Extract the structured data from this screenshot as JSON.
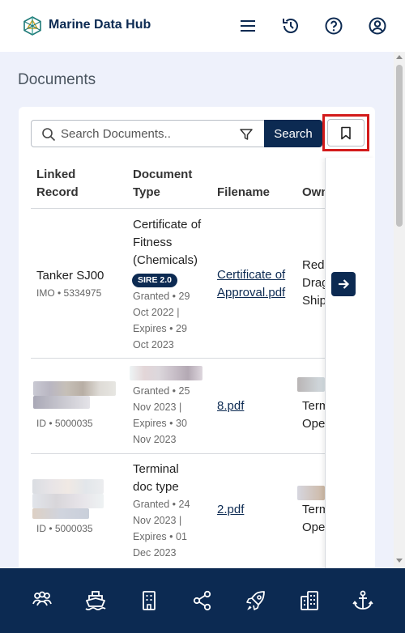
{
  "header": {
    "brand": "Marine Data Hub",
    "icons": [
      "hex-logo-icon",
      "menu-icon",
      "history-icon",
      "help-icon",
      "account-icon"
    ]
  },
  "page": {
    "title": "Documents"
  },
  "search": {
    "placeholder": "Search Documents..",
    "button_label": "Search"
  },
  "table": {
    "columns": [
      "Linked Record",
      "Document Type",
      "Filename",
      "Owner"
    ],
    "col1_head": [
      "Linked",
      "Record"
    ],
    "col2_head": [
      "Document",
      "Type"
    ],
    "col3_head": "Filename",
    "col4_head": "Own",
    "rows": [
      {
        "record": "Tanker SJ00",
        "record_sub": "IMO • 5334975",
        "doctype": [
          "Certificate of",
          "Fitness",
          "(Chemicals)"
        ],
        "badge": "SIRE 2.0",
        "dates": [
          "Granted • 29",
          "Oct 2022 |",
          "Expires • 29",
          "Oct 2023"
        ],
        "filename": [
          "Certificate of",
          "Approval.pdf"
        ],
        "owner": [
          "Red",
          "Drag",
          "Ship"
        ]
      },
      {
        "record": "Terminal",
        "record_sub": "ID • 5000035",
        "doctype": [],
        "badge": "",
        "dates": [
          "Granted • 25",
          "Nov 2023 |",
          "Expires • 30",
          "Nov 2023"
        ],
        "filename": [
          "8.pdf"
        ],
        "owner": [
          "Term",
          "Ope"
        ]
      },
      {
        "record": "",
        "record_sub": "ID • 5000035",
        "doctype": [
          "Terminal",
          "doc type"
        ],
        "badge": "",
        "dates": [
          "Granted • 24",
          "Nov 2023 |",
          "Expires • 01",
          "Dec 2023"
        ],
        "filename": [
          "2.pdf"
        ],
        "owner": [
          "Term",
          "Ope"
        ]
      }
    ]
  },
  "bottom_nav": {
    "icons": [
      "people-icon",
      "ship-icon",
      "building-icon",
      "share-icon",
      "rocket-icon",
      "office-buildings-icon",
      "anchor-icon"
    ]
  },
  "colors": {
    "brand_navy": "#0c2a52",
    "page_bg": "#eef1fb",
    "highlight_red": "#d31b1b"
  }
}
